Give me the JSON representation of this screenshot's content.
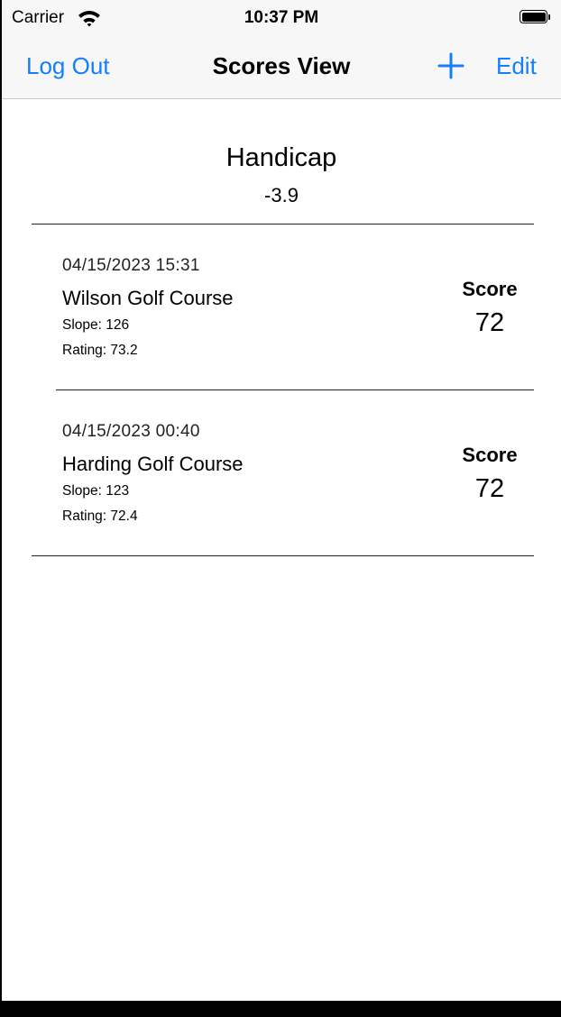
{
  "status_bar": {
    "carrier": "Carrier",
    "time": "10:37 PM",
    "wifi_icon": "wifi-icon",
    "battery_icon": "battery-icon"
  },
  "nav": {
    "left_label": "Log Out",
    "title": "Scores View",
    "add_icon": "plus-icon",
    "right_label": "Edit",
    "accent_color": "#147efb"
  },
  "handicap": {
    "label": "Handicap",
    "value": "-3.9"
  },
  "scores": [
    {
      "date": "04/15/2023 15:31",
      "course": "Wilson Golf Course",
      "slope": "Slope: 126",
      "rating": "Rating: 73.2",
      "score_label": "Score",
      "score": "72"
    },
    {
      "date": "04/15/2023 00:40",
      "course": "Harding Golf Course",
      "slope": "Slope: 123",
      "rating": "Rating: 72.4",
      "score_label": "Score",
      "score": "72"
    }
  ]
}
